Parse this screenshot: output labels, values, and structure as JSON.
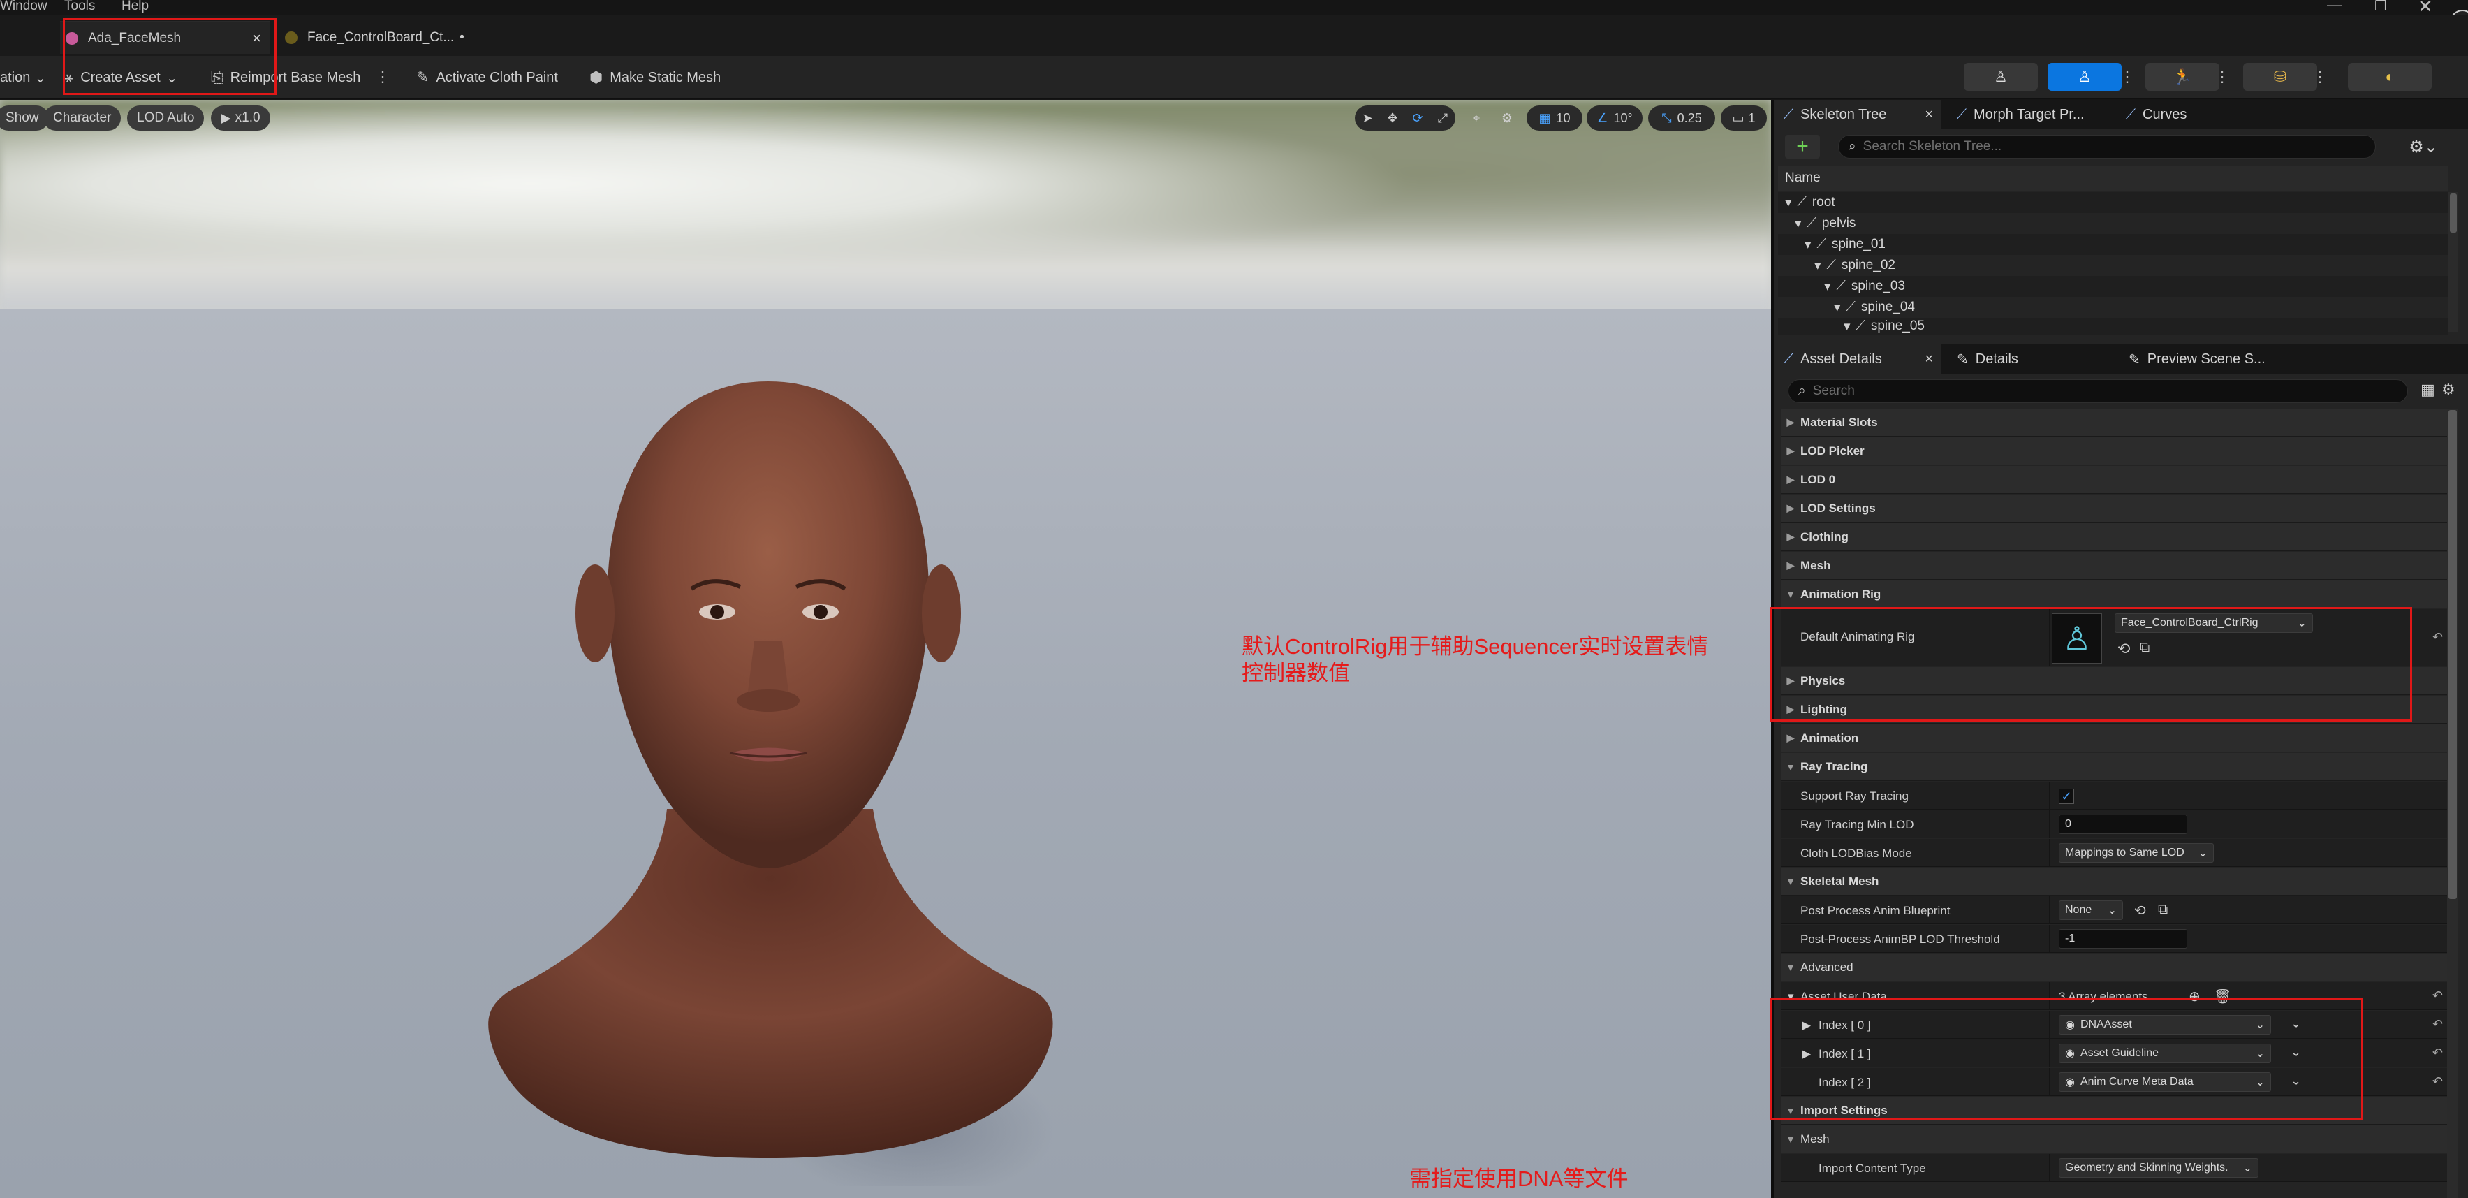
{
  "menubar": {
    "window": "Window",
    "tools": "Tools",
    "help": "Help"
  },
  "tabs": [
    {
      "label": "Ada_FaceMesh",
      "close": "×"
    },
    {
      "label": "Face_ControlBoard_Ct...",
      "dirty": "•"
    }
  ],
  "toolbar": {
    "animation": "ation",
    "create_asset": "Create Asset",
    "reimport": "Reimport Base Mesh",
    "cloth_paint": "Activate Cloth Paint",
    "make_static": "Make Static Mesh"
  },
  "viewport": {
    "show": "Show",
    "character": "Character",
    "lod": "LOD Auto",
    "speed": "x1.0",
    "grid": "10",
    "angle": "10°",
    "scale": "0.25",
    "cams": "1"
  },
  "annotations": {
    "control_rig": "默认ControlRig用于辅助Sequencer实时设置表情",
    "control_rig2": "控制器数值",
    "dna": "需指定使用DNA等文件"
  },
  "skeleton_panel": {
    "tabs": [
      "Skeleton Tree",
      "Morph Target Pr...",
      "Curves"
    ],
    "close": "×",
    "search_placeholder": "Search Skeleton Tree...",
    "column": "Name",
    "bones": [
      "root",
      "pelvis",
      "spine_01",
      "spine_02",
      "spine_03",
      "spine_04",
      "spine_05"
    ]
  },
  "details_panel": {
    "tabs": [
      "Asset Details",
      "Details",
      "Preview Scene S..."
    ],
    "close": "×",
    "search_placeholder": "Search",
    "categories": {
      "material_slots": "Material Slots",
      "lod_picker": "LOD Picker",
      "lod0": "LOD 0",
      "lod_settings": "LOD Settings",
      "clothing": "Clothing",
      "mesh": "Mesh",
      "animation_rig": "Animation Rig",
      "physics": "Physics",
      "lighting": "Lighting",
      "animation": "Animation",
      "ray_tracing": "Ray Tracing",
      "skeletal_mesh": "Skeletal Mesh",
      "advanced": "Advanced",
      "import_settings": "Import Settings",
      "mesh2": "Mesh"
    },
    "props": {
      "default_rig_label": "Default Animating Rig",
      "default_rig_value": "Face_ControlBoard_CtrlRig",
      "support_rt": "Support Ray Tracing",
      "rt_min_lod": "Ray Tracing Min LOD",
      "rt_min_lod_value": "0",
      "cloth_lod": "Cloth LODBias Mode",
      "cloth_lod_value": "Mappings to Same LOD",
      "post_process": "Post Process Anim Blueprint",
      "post_process_value": "None",
      "animbp_lod": "Post-Process AnimBP LOD Threshold",
      "animbp_lod_value": "-1",
      "asset_user_data": "Asset User Data",
      "array_count": "3 Array elements",
      "index0": "Index [ 0 ]",
      "index0_value": "DNAAsset",
      "index1": "Index [ 1 ]",
      "index1_value": "Asset Guideline",
      "index2": "Index [ 2 ]",
      "index2_value": "Anim Curve Meta Data",
      "import_content": "Import Content Type",
      "import_content_value": "Geometry and Skinning Weights."
    }
  }
}
